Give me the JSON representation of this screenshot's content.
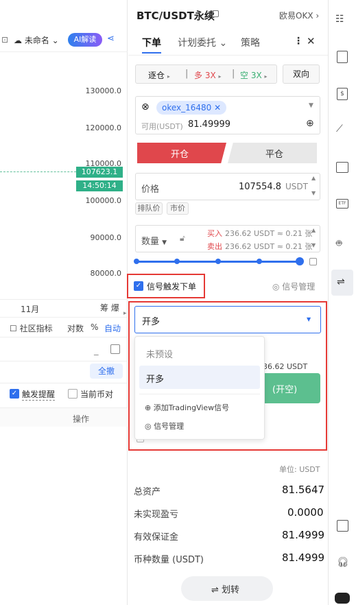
{
  "chart": {
    "toolbar_unnamed": "未命名",
    "ai_button": "AI解读",
    "y_ticks": [
      "130000.0",
      "120000.0",
      "110000.0",
      "100000.0",
      "90000.0",
      "80000.0"
    ],
    "price_tag": "107623.1",
    "time_tag": "14:50:14",
    "x_label": "11月",
    "x_right": "筹  爆",
    "indicators": "社区指标",
    "contracts": "对数",
    "percent": "%",
    "auto": "自动",
    "undo_all": "全撤",
    "trigger_alert": "触发提醒",
    "current_pair": "当前币对",
    "operation": "操作"
  },
  "header": {
    "pair": "BTC/USDT永续",
    "exchange": "欧易OKX",
    "tabs": [
      "下单",
      "计划委托",
      "策略"
    ]
  },
  "order": {
    "margin_mode": "逐仓",
    "long_lev": "多 3X",
    "short_lev": "空 3X",
    "direction": "双向",
    "account_tag": "okex_16480",
    "available_label": "可用(USDT)",
    "available_value": "81.49999",
    "open_tab": "开仓",
    "close_tab": "平仓",
    "price_label": "价格",
    "price_value": "107554.8",
    "price_unit": "USDT",
    "queue_price": "排队价",
    "market_price": "市价",
    "qty_label": "数量",
    "buy_label": "买入",
    "buy_value": "236.62 USDT ≈ 0.21 张",
    "sell_label": "卖出",
    "sell_value": "236.62 USDT ≈ 0.21 张",
    "signal_trigger": "信号触发下单",
    "signal_manage": "信号管理",
    "selected_signal": "开多",
    "dropdown_items": [
      "未预设",
      "开多"
    ],
    "add_tv": "添加TradingView信号",
    "manage_signal": "信号管理",
    "obscured_text": "36.62 USDT",
    "short_button": "(开空)"
  },
  "assets": {
    "unit": "单位: USDT",
    "rows": [
      {
        "label": "总资产",
        "value": "81.5647"
      },
      {
        "label": "未实现盈亏",
        "value": "0.0000"
      },
      {
        "label": "有效保证金",
        "value": "81.4999"
      },
      {
        "label": "币种数量 (USDT)",
        "value": "81.4999"
      }
    ],
    "transfer": "划转"
  },
  "colors": {
    "accent": "#2f6fed",
    "red": "#e0474c",
    "green": "#3aaf73"
  }
}
